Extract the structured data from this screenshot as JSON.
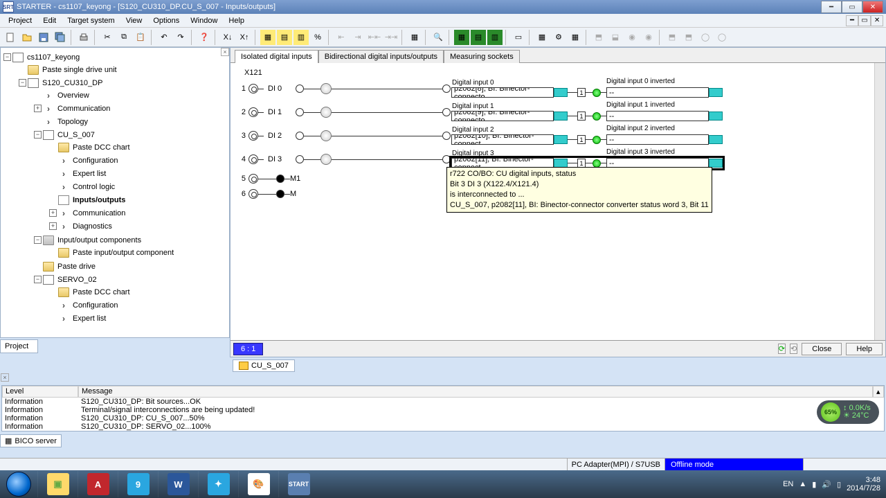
{
  "window": {
    "title": "STARTER - cs1107_keyong - [S120_CU310_DP.CU_S_007 - Inputs/outputs]",
    "app_icon": "SRT"
  },
  "menu": [
    "Project",
    "Edit",
    "Target system",
    "View",
    "Options",
    "Window",
    "Help"
  ],
  "tree": {
    "root": "cs1107_keyong",
    "items": {
      "paste_single": "Paste single drive unit",
      "s120": "S120_CU310_DP",
      "overview": "Overview",
      "communication1": "Communication",
      "topology": "Topology",
      "cu": "CU_S_007",
      "paste_dcc1": "Paste DCC chart",
      "config1": "Configuration",
      "expert1": "Expert list",
      "control_logic": "Control logic",
      "io": "Inputs/outputs",
      "communication2": "Communication",
      "diagnostics": "Diagnostics",
      "ioc": "Input/output components",
      "paste_ioc": "Paste input/output component",
      "paste_drive": "Paste drive",
      "servo": "SERVO_02",
      "paste_dcc2": "Paste DCC chart",
      "config2": "Configuration",
      "expert2": "Expert list"
    }
  },
  "project_tab": "Project",
  "tabs": [
    "Isolated digital inputs",
    "Bidirectional digital inputs/outputs",
    "Measuring sockets"
  ],
  "terminal": "X121",
  "di": [
    {
      "n": "1",
      "lbl": "DI 0",
      "title": "Digital input 0",
      "sig": "p2082[8], BI: Binector-connecto",
      "inv": "Digital input 0 inverted",
      "ival": "--"
    },
    {
      "n": "2",
      "lbl": "DI 1",
      "title": "Digital input 1",
      "sig": "p2082[9], BI: Binector-connecto",
      "inv": "Digital input 1 inverted",
      "ival": "--"
    },
    {
      "n": "3",
      "lbl": "DI 2",
      "title": "Digital input 2",
      "sig": "p2082[10], BI: Binector-connect",
      "inv": "Digital input 2 inverted",
      "ival": "--"
    },
    {
      "n": "4",
      "lbl": "DI 3",
      "title": "Digital input 3",
      "sig": "p2082[11], BI: Binector-connect",
      "inv": "Digital input 3 inverted",
      "ival": "--"
    }
  ],
  "extra_pins": [
    {
      "n": "5",
      "lbl": "M1"
    },
    {
      "n": "6",
      "lbl": "M"
    }
  ],
  "tooltip": {
    "l1": "r722 CO/BO: CU digital inputs, status",
    "l2": "Bit 3 DI 3 (X122.4/X121.4)",
    "l3": "is interconnected to ...",
    "l4": "CU_S_007, p2082[11], BI: Binector-connector converter status word 3, Bit 11"
  },
  "zoom": "6 : 1",
  "buttons": {
    "close": "Close",
    "help": "Help"
  },
  "doc_tab": "CU_S_007",
  "msg_cols": {
    "level": "Level",
    "message": "Message"
  },
  "messages": [
    {
      "lvl": "Information",
      "msg": "S120_CU310_DP: Bit sources...OK"
    },
    {
      "lvl": "Information",
      "msg": "Terminal/signal interconnections are being updated!"
    },
    {
      "lvl": "Information",
      "msg": "S120_CU310_DP: CU_S_007...50%"
    },
    {
      "lvl": "Information",
      "msg": "S120_CU310_DP: SERVO_02...100%"
    }
  ],
  "bico": "BICO server",
  "status": {
    "adapter": "PC Adapter(MPI)  /  S7USB",
    "offline": "Offline mode"
  },
  "widget": {
    "mem": "65%",
    "speed": "0.0K/s",
    "temp": "24°C"
  },
  "tray": {
    "lang": "EN",
    "time": "3:48",
    "date": "2014/7/28"
  }
}
